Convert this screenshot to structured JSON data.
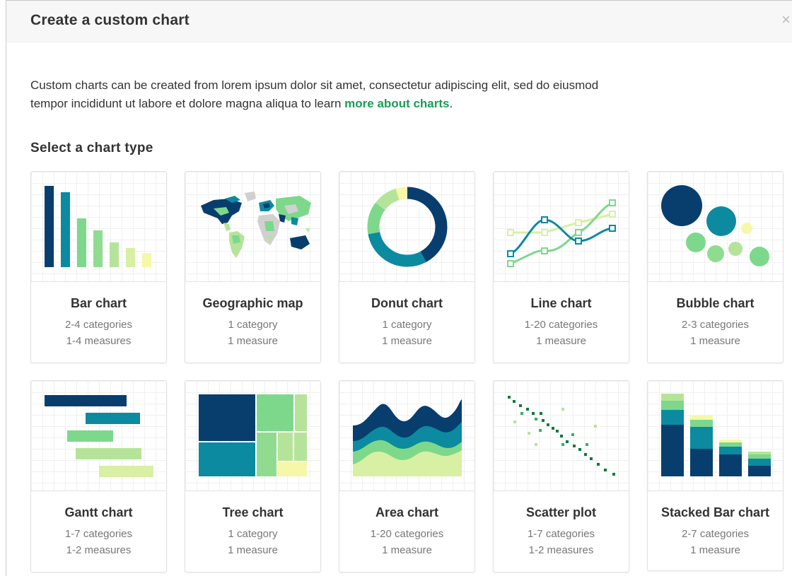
{
  "dialog": {
    "title": "Create a custom chart",
    "close_glyph": "×",
    "intro_text": "Custom charts can be created from lorem ipsum dolor sit amet, consectetur adipiscing elit, sed do eiusmod tempor incididunt ut labore et dolore magna aliqua to learn ",
    "intro_link": "more about charts",
    "intro_end": ".",
    "section_title": "Select a chart type"
  },
  "colors": {
    "navy": "#073e6e",
    "teal": "#0b8aa0",
    "green": "#7dd88c",
    "light_green": "#b6e39a",
    "yellow": "#f6f7a8",
    "link": "#1a9c57"
  },
  "cards": [
    {
      "name": "Bar chart",
      "line1": "2-4 categories",
      "line2": "1-4 measures",
      "icon": "bar-chart-icon"
    },
    {
      "name": "Geographic map",
      "line1": "1 category",
      "line2": "1 measure",
      "icon": "world-map-icon"
    },
    {
      "name": "Donut chart",
      "line1": "1 category",
      "line2": "1 measure",
      "icon": "donut-chart-icon"
    },
    {
      "name": "Line chart",
      "line1": "1-20 categories",
      "line2": "1 measure",
      "icon": "line-chart-icon"
    },
    {
      "name": "Bubble chart",
      "line1": "2-3 categories",
      "line2": "1 measure",
      "icon": "bubble-chart-icon"
    },
    {
      "name": "Gantt chart",
      "line1": "1-7 categories",
      "line2": "1-2 measures",
      "icon": "gantt-chart-icon"
    },
    {
      "name": "Tree chart",
      "line1": "1 category",
      "line2": "1 measure",
      "icon": "tree-chart-icon"
    },
    {
      "name": "Area chart",
      "line1": "1-20 categories",
      "line2": "1 measure",
      "icon": "area-chart-icon"
    },
    {
      "name": "Scatter plot",
      "line1": "1-7 categories",
      "line2": "1-2 measures",
      "icon": "scatter-plot-icon"
    },
    {
      "name": "Stacked Bar chart",
      "line1": "2-7 categories",
      "line2": "1 measure",
      "icon": "stacked-bar-chart-icon"
    }
  ]
}
